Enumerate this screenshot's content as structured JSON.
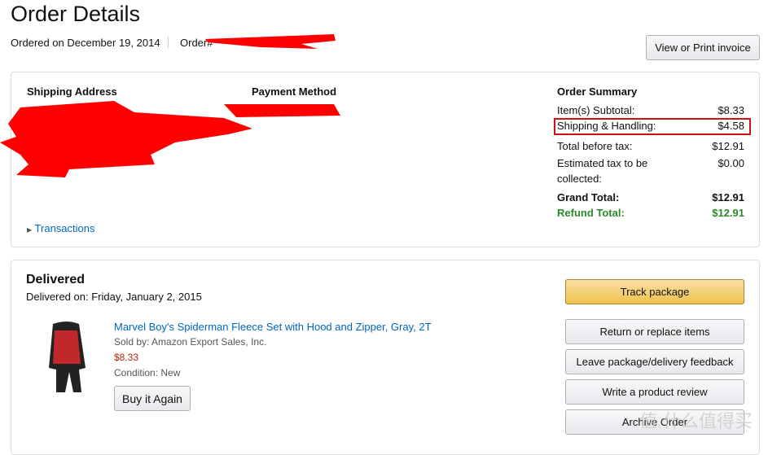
{
  "header": {
    "title": "Order Details",
    "ordered_on": "Ordered on December 19, 2014",
    "order_label": "Order#",
    "invoice_button": "View or Print invoice"
  },
  "details": {
    "shipping_heading": "Shipping Address",
    "payment_heading": "Payment Method",
    "transactions_link": "Transactions",
    "summary": {
      "heading": "Order Summary",
      "rows": [
        {
          "label": "Item(s) Subtotal:",
          "value": "$8.33"
        },
        {
          "label": "Shipping & Handling:",
          "value": "$4.58",
          "highlighted": true
        },
        {
          "label": "Total before tax:",
          "value": "$12.91"
        },
        {
          "label": "Estimated tax to be collected:",
          "value": "$0.00"
        }
      ],
      "grand_total_label": "Grand Total:",
      "grand_total": "$12.91",
      "refund_total_label": "Refund Total:",
      "refund_total": "$12.91",
      "highlight_color": "#cc1111",
      "refund_color": "#2a8a2a"
    }
  },
  "shipment": {
    "status": "Delivered",
    "delivered_on": "Delivered on: Friday, January 2, 2015",
    "item": {
      "title": "Marvel Boy's Spiderman Fleece Set with Hood and Zipper, Gray, 2T",
      "sold_by": "Sold by: Amazon Export Sales, Inc.",
      "price": "$8.33",
      "condition": "Condition: New",
      "buy_again": "Buy it Again"
    },
    "actions": {
      "track": "Track package",
      "return": "Return or replace items",
      "feedback": "Leave package/delivery feedback",
      "review": "Write a product review",
      "archive": "Archive Order"
    }
  },
  "watermark": "值 什么值得买",
  "colors": {
    "link": "#0066c0",
    "price": "#b12704",
    "track_button": "#f0c14b",
    "redaction": "#ff0000"
  }
}
